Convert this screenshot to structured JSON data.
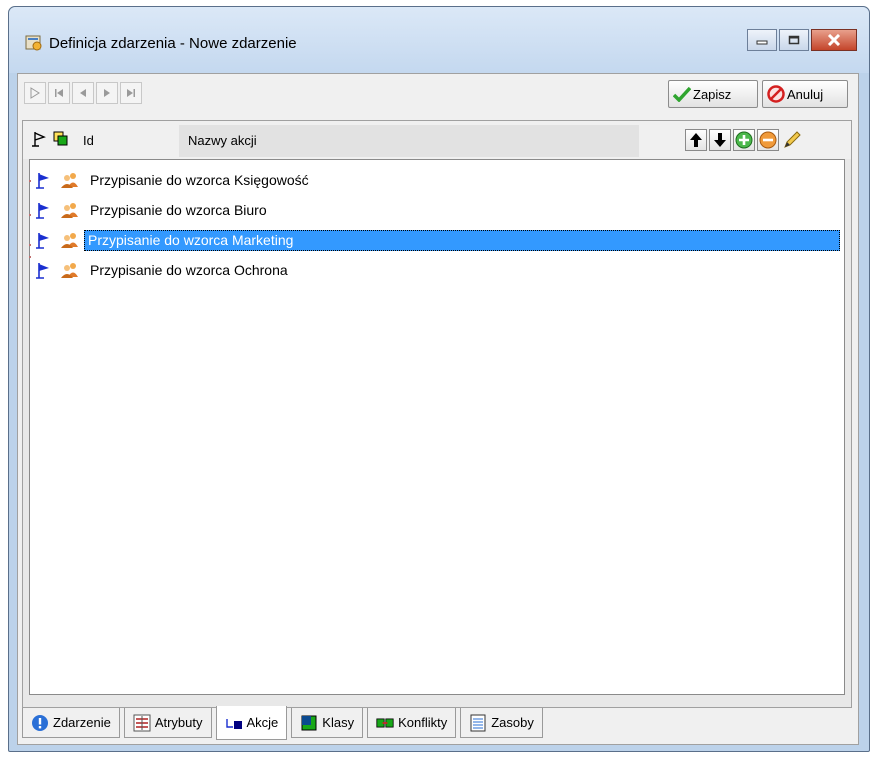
{
  "window": {
    "title": "Definicja zdarzenia - Nowe zdarzenie",
    "buttons": {
      "minimize": "minimize",
      "maximize": "maximize",
      "close": "close"
    }
  },
  "toolbar": {
    "nav_icons": [
      "new-record-icon",
      "first-record-icon",
      "previous-record-icon",
      "next-record-icon",
      "last-record-icon"
    ],
    "save_label": "Zapisz",
    "cancel_label": "Anuluj"
  },
  "grid": {
    "columns": {
      "id": "Id",
      "name": "Nazwy akcji"
    },
    "tools": [
      "arrow-up-icon",
      "arrow-down-icon",
      "add-icon",
      "remove-icon",
      "edit-icon"
    ],
    "rows": [
      {
        "label": "Przypisanie do wzorca Księgowość",
        "selected": false
      },
      {
        "label": "Przypisanie do wzorca Biuro",
        "selected": false
      },
      {
        "label": "Przypisanie do wzorca Marketing",
        "selected": true
      },
      {
        "label": "Przypisanie do wzorca Ochrona",
        "selected": false
      }
    ],
    "selection_color": "#3399ff"
  },
  "tabs": [
    {
      "label": "Zdarzenie",
      "icon": "info-icon",
      "active": false
    },
    {
      "label": "Atrybuty",
      "icon": "attributes-icon",
      "active": false
    },
    {
      "label": "Akcje",
      "icon": "action-arrow-icon",
      "active": true
    },
    {
      "label": "Klasy",
      "icon": "class-icon",
      "active": false
    },
    {
      "label": "Konflikty",
      "icon": "conflict-icon",
      "active": false
    },
    {
      "label": "Zasoby",
      "icon": "resources-icon",
      "active": false
    }
  ]
}
